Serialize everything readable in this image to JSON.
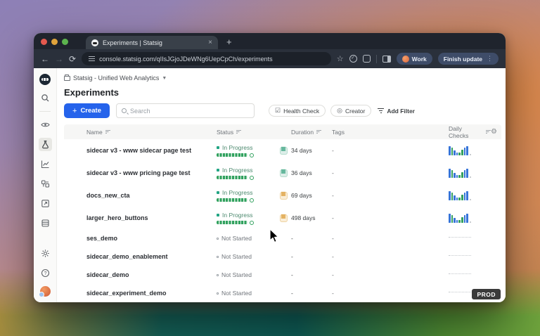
{
  "browser": {
    "tab_title": "Experiments | Statsig",
    "url": "console.statsig.com/qIIsJGjoJDeWNg6UepCpCh/experiments",
    "profile_label": "Work",
    "update_button": "Finish update"
  },
  "app": {
    "breadcrumb": "Statsig - Unified Web Analytics",
    "page_title": "Experiments",
    "create_button": "Create",
    "search_placeholder": "Search",
    "filters": [
      {
        "label": "Health Check",
        "icon": "health-check-icon"
      },
      {
        "label": "Creator",
        "icon": "creator-icon"
      },
      {
        "label": "Add Filter",
        "icon": "filter-icon"
      }
    ],
    "env_badge": "PROD"
  },
  "table": {
    "headers": [
      {
        "label": "Name",
        "sortable": true
      },
      {
        "label": "Status",
        "sortable": true
      },
      {
        "label": "Duration",
        "sortable": true
      },
      {
        "label": "Tags",
        "sortable": false
      },
      {
        "label": "Daily Checks",
        "sortable": true
      }
    ],
    "rows": [
      {
        "name": "sidecar v3 - www sidecar page test",
        "status": "In Progress",
        "status_type": "in-progress",
        "duration": "34 days",
        "duration_health": "good",
        "tags": "-",
        "daily_checks": "sparkline"
      },
      {
        "name": "sidecar v3 - www pricing page test",
        "status": "In Progress",
        "status_type": "in-progress",
        "duration": "36 days",
        "duration_health": "good",
        "tags": "-",
        "daily_checks": "sparkline"
      },
      {
        "name": "docs_new_cta",
        "status": "In Progress",
        "status_type": "in-progress",
        "duration": "69 days",
        "duration_health": "warn",
        "tags": "-",
        "daily_checks": "sparkline"
      },
      {
        "name": "larger_hero_buttons",
        "status": "In Progress",
        "status_type": "in-progress",
        "duration": "498 days",
        "duration_health": "warn",
        "tags": "-",
        "daily_checks": "sparkline"
      },
      {
        "name": "ses_demo",
        "status": "Not Started",
        "status_type": "not-started",
        "duration": "-",
        "duration_health": "none",
        "tags": "-",
        "daily_checks": "none"
      },
      {
        "name": "sidecar_demo_enablement",
        "status": "Not Started",
        "status_type": "not-started",
        "duration": "-",
        "duration_health": "none",
        "tags": "-",
        "daily_checks": "none"
      },
      {
        "name": "sidecar_demo",
        "status": "Not Started",
        "status_type": "not-started",
        "duration": "-",
        "duration_health": "none",
        "tags": "-",
        "daily_checks": "none"
      },
      {
        "name": "sidecar_experiment_demo",
        "status": "Not Started",
        "status_type": "not-started",
        "duration": "-",
        "duration_health": "none",
        "tags": "-",
        "daily_checks": "none"
      }
    ]
  },
  "sparkline": {
    "heights": [
      13,
      11,
      7,
      4,
      4,
      8,
      11,
      13
    ],
    "colors": [
      "blue",
      "green",
      "blue",
      "blue",
      "green",
      "green",
      "blue",
      "blue"
    ]
  },
  "colors": {
    "accent_blue": "#2563eb",
    "status_green": "#31a15e",
    "warn_orange": "#dd9e3a",
    "bar_blue": "#3674d9",
    "bar_green": "#34a05f"
  }
}
